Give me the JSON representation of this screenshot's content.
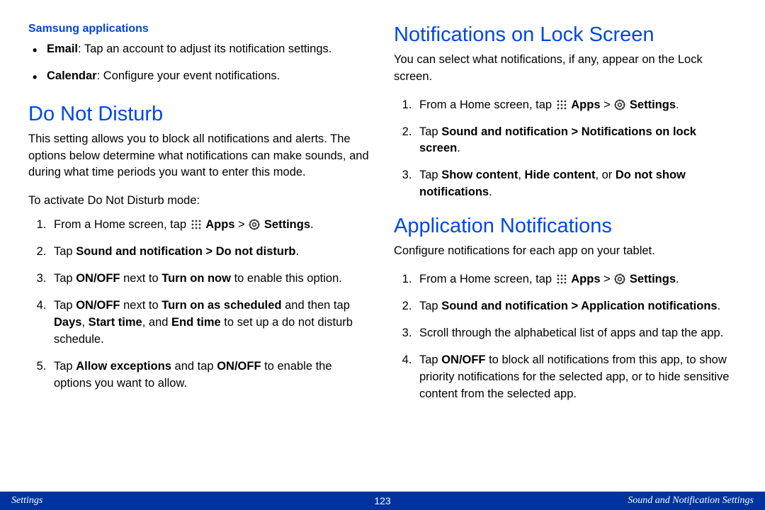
{
  "left": {
    "samsung_heading": "Samsung applications",
    "bullets": {
      "email_label": "Email",
      "email_rest": ": Tap an account to adjust its notification settings.",
      "calendar_label": "Calendar",
      "calendar_rest": ": Configure your event notifications."
    },
    "dnd_heading": "Do Not Disturb",
    "dnd_intro": "This setting allows you to block all notifications and alerts. The options below determine what notifications can make sounds, and during what time periods you want to enter this mode.",
    "dnd_leadin": "To activate Do Not Disturb mode:",
    "steps": {
      "s1_pre": "From a Home screen, tap ",
      "s1_apps": "Apps",
      "s1_gt": " > ",
      "s1_settings": "Settings",
      "s1_end": ".",
      "s2_pre": "Tap ",
      "s2_bold": "Sound and notification > Do not disturb",
      "s2_end": ".",
      "s3_a": "Tap ",
      "s3_b": "ON/OFF",
      "s3_c": " next to ",
      "s3_d": "Turn on now",
      "s3_e": " to enable this option.",
      "s4_a": "Tap ",
      "s4_b": "ON/OFF",
      "s4_c": " next to ",
      "s4_d": "Turn on as scheduled",
      "s4_e": " and then tap ",
      "s4_f": "Days",
      "s4_g": ", ",
      "s4_h": "Start time",
      "s4_i": ", and ",
      "s4_j": "End time",
      "s4_k": " to set up a do not disturb schedule.",
      "s5_a": "Tap ",
      "s5_b": "Allow exceptions",
      "s5_c": " and tap ",
      "s5_d": "ON/OFF",
      "s5_e": " to enable the options you want to allow."
    }
  },
  "right": {
    "lock_heading": "Notifications on Lock Screen",
    "lock_intro": "You can select what notifications, if any, appear on the Lock screen.",
    "lock_steps": {
      "s1_pre": "From a Home screen, tap ",
      "s1_apps": "Apps",
      "s1_gt": " > ",
      "s1_settings": "Settings",
      "s1_end": ".",
      "s2_pre": "Tap ",
      "s2_bold": "Sound and notification > Notifications on lock screen",
      "s2_end": ".",
      "s3_a": "Tap ",
      "s3_b": "Show content",
      "s3_c": ", ",
      "s3_d": "Hide content",
      "s3_e": ", or ",
      "s3_f": "Do not show notifications",
      "s3_g": "."
    },
    "app_heading": "Application Notifications",
    "app_intro": "Configure notifications for each app on your tablet.",
    "app_steps": {
      "s1_pre": "From a Home screen, tap ",
      "s1_apps": "Apps",
      "s1_gt": " > ",
      "s1_settings": "Settings",
      "s1_end": ".",
      "s2_pre": "Tap ",
      "s2_bold": "Sound and notification > Application notifications",
      "s2_end": ".",
      "s3": "Scroll through the alphabetical list of apps and tap the app.",
      "s4_a": "Tap ",
      "s4_b": "ON/OFF",
      "s4_c": " to block all notifications from this app, to show priority notifications for the selected app, or to hide sensitive content from the selected app."
    }
  },
  "footer": {
    "left": "Settings",
    "center": "123",
    "right": "Sound and Notification Settings"
  }
}
